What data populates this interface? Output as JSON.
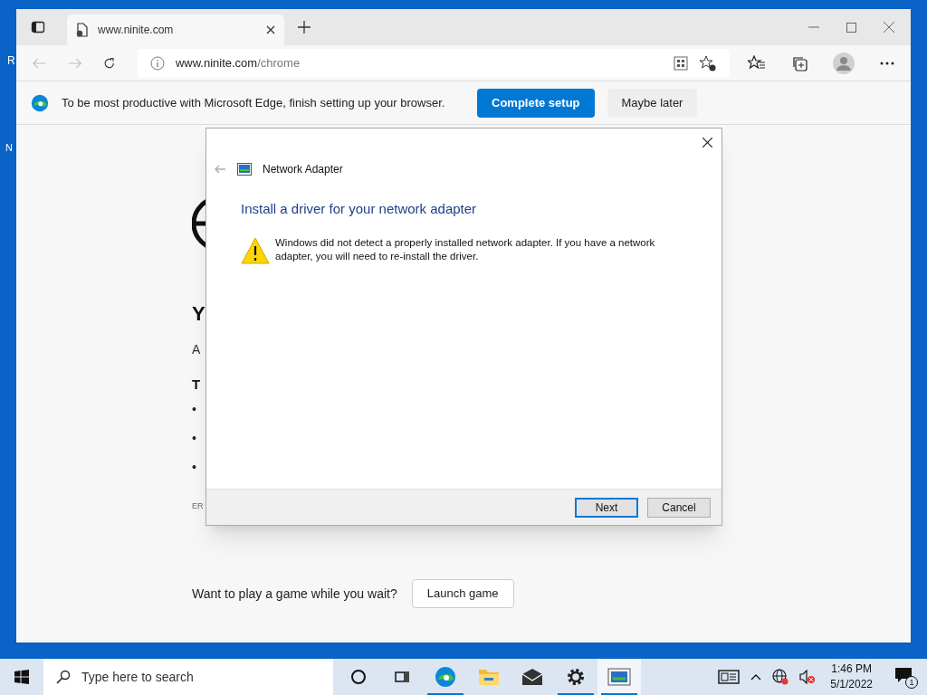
{
  "desktop": {
    "icon_labels": [
      "R",
      "N"
    ]
  },
  "browser": {
    "tab": {
      "title": "www.ninite.com"
    },
    "address": {
      "domain": "www.ninite.com",
      "path": "/chrome"
    },
    "infobar": {
      "message": "To be most productive with Microsoft Edge, finish setting up your browser.",
      "buttons": [
        {
          "label": "Complete setup",
          "kind": "primary"
        },
        {
          "label": "Maybe later",
          "kind": "secondary"
        }
      ]
    },
    "page": {
      "heading": "Y",
      "paragraph": "A",
      "subheading": "T",
      "bullets": [
        "•",
        "•",
        "•"
      ],
      "error_code": "ER",
      "game_prompt": "Want to play a game while you wait?",
      "game_button": "Launch game"
    }
  },
  "dialog": {
    "title": "Network Adapter",
    "heading": "Install a driver for your network adapter",
    "message": "Windows did not detect a properly installed network adapter. If you have a network adapter, you will need to re-install the driver.",
    "buttons": [
      {
        "label": "Next",
        "default": true
      },
      {
        "label": "Cancel",
        "default": false
      }
    ]
  },
  "taskbar": {
    "search_placeholder": "Type here to search",
    "apps": [
      {
        "kind": "cortana",
        "running": false,
        "selected": false
      },
      {
        "kind": "taskview",
        "running": false,
        "selected": false
      },
      {
        "kind": "edge",
        "running": true,
        "selected": false
      },
      {
        "kind": "explorer",
        "running": false,
        "selected": false
      },
      {
        "kind": "mail",
        "running": false,
        "selected": false
      },
      {
        "kind": "settings",
        "running": true,
        "selected": false
      },
      {
        "kind": "network",
        "running": true,
        "selected": true
      }
    ],
    "time": "1:46 PM",
    "date": "5/1/2022",
    "notification_count": "1"
  }
}
